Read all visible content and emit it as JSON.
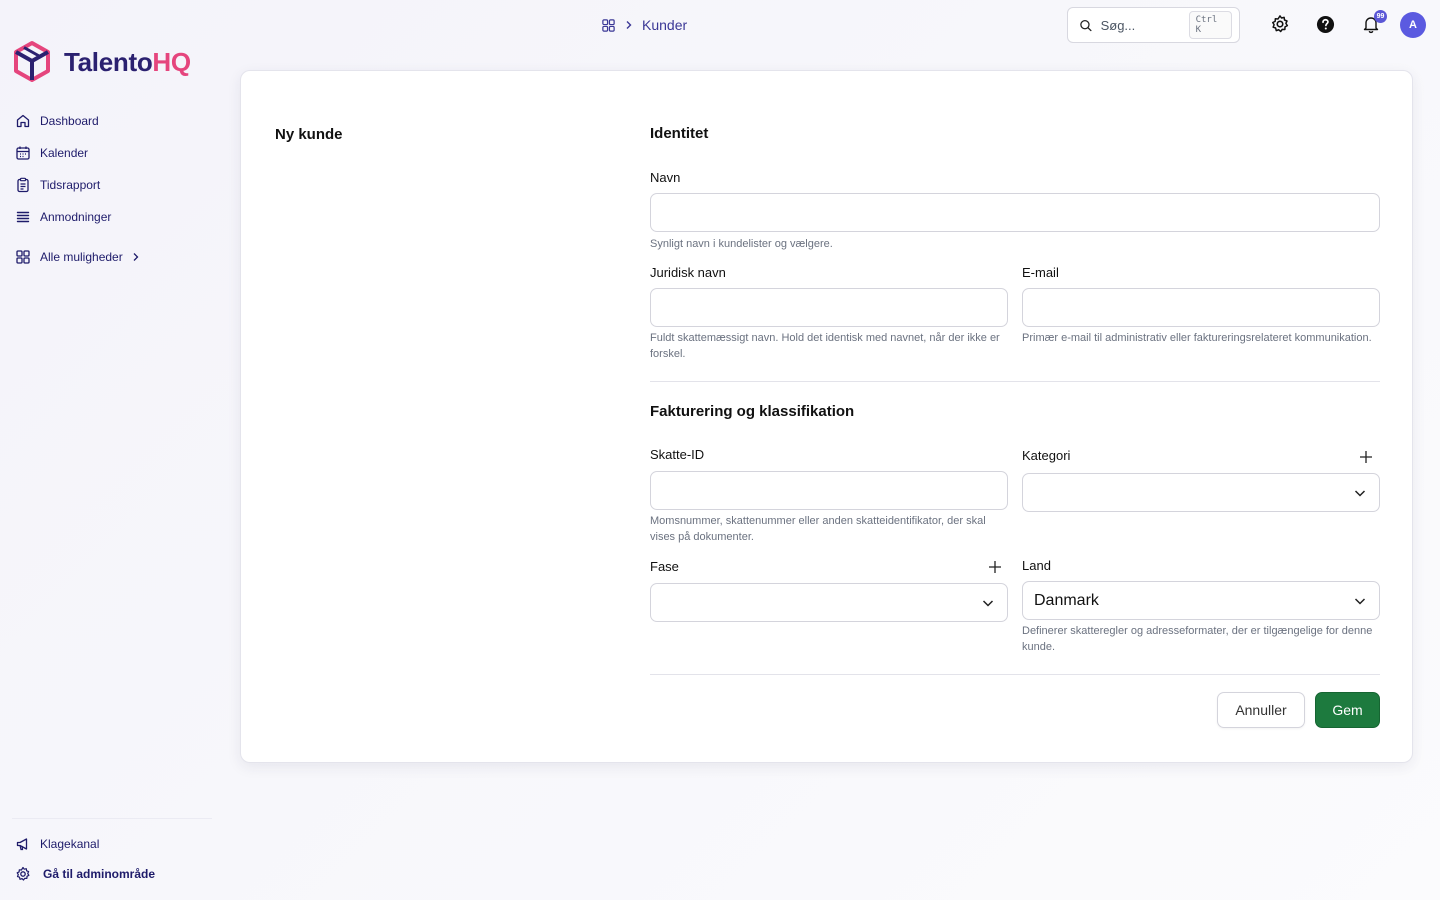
{
  "brand": {
    "name_main": "Talento",
    "name_accent": "HQ",
    "colors": {
      "primary": "#2b2170",
      "accent": "#e5457d",
      "save": "#1d7a3e",
      "avatar": "#5b5ae0"
    }
  },
  "sidebar": {
    "items": [
      {
        "label": "Dashboard",
        "icon": "home-icon"
      },
      {
        "label": "Kalender",
        "icon": "calendar-icon"
      },
      {
        "label": "Tidsrapport",
        "icon": "clipboard-icon"
      },
      {
        "label": "Anmodninger",
        "icon": "list-icon"
      }
    ],
    "more": {
      "label": "Alle muligheder",
      "icon": "grid-icon"
    },
    "bottom": [
      {
        "label": "Klagekanal",
        "icon": "megaphone-icon"
      },
      {
        "label": "Gå til adminområde",
        "icon": "gear-icon"
      }
    ]
  },
  "topbar": {
    "breadcrumb": {
      "current": "Kunder"
    },
    "search": {
      "placeholder": "Søg...",
      "shortcut": "Ctrl K"
    },
    "notifications_count": "99",
    "avatar_initial": "A"
  },
  "page": {
    "title": "Ny kunde"
  },
  "form": {
    "identity": {
      "title": "Identitet",
      "name_label": "Navn",
      "name_value": "",
      "name_help": "Synligt navn i kundelister og vælgere.",
      "legal_label": "Juridisk navn",
      "legal_value": "",
      "legal_help": "Fuldt skattemæssigt navn. Hold det identisk med navnet, når der ikke er forskel.",
      "email_label": "E-mail",
      "email_value": "",
      "email_help": "Primær e-mail til administrativ eller faktureringsrelateret kommunikation."
    },
    "billing": {
      "title": "Fakturering og klassifikation",
      "tax_label": "Skatte-ID",
      "tax_value": "",
      "tax_help": "Momsnummer, skattenummer eller anden skatteidentifikator, der skal vises på dokumenter.",
      "category_label": "Kategori",
      "category_value": "",
      "phase_label": "Fase",
      "phase_value": "",
      "country_label": "Land",
      "country_value": "Danmark",
      "country_help": "Definerer skatteregler og adresseformater, der er tilgængelige for denne kunde."
    },
    "actions": {
      "cancel": "Annuller",
      "save": "Gem"
    }
  }
}
